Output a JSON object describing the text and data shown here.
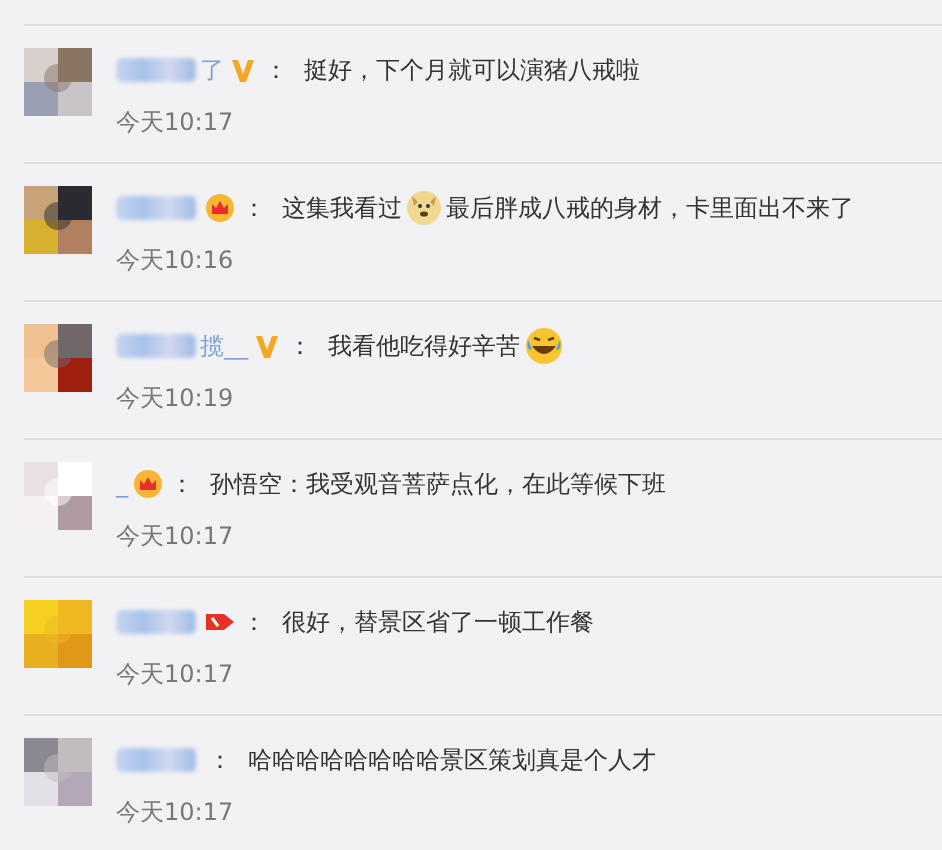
{
  "comments": [
    {
      "name": "了",
      "blurred": true,
      "badge": {
        "kind": "v"
      },
      "separator": "：",
      "parts": [
        {
          "kind": "text",
          "text": "挺好，下个月就可以演猪八戒啦"
        }
      ],
      "time": "今天10:17"
    },
    {
      "blurred": true,
      "badge": {
        "kind": "crown"
      },
      "separator": "：",
      "parts": [
        {
          "kind": "text",
          "text": "这集我看过"
        },
        {
          "kind": "dog"
        },
        {
          "kind": "text",
          "text": "最后胖成八戒的身材，卡里面出不来了"
        }
      ],
      "time": "今天10:16"
    },
    {
      "name": "揽__",
      "blurred": true,
      "badge": {
        "kind": "v"
      },
      "separator": "：",
      "parts": [
        {
          "kind": "text",
          "text": "我看他吃得好辛苦"
        },
        {
          "kind": "laugh"
        }
      ],
      "time": "今天10:19"
    },
    {
      "name": "_",
      "blurred": false,
      "badge": {
        "kind": "crown"
      },
      "separator": "：",
      "parts": [
        {
          "kind": "text",
          "text": "孙悟空：我受观音菩萨点化，在此等候下班"
        }
      ],
      "time": "今天10:17"
    },
    {
      "blurred": true,
      "badge": {
        "kind": "tag"
      },
      "separator": "：",
      "parts": [
        {
          "kind": "text",
          "text": "很好，替景区省了一顿工作餐"
        }
      ],
      "time": "今天10:17"
    },
    {
      "blurred": true,
      "separator": "：",
      "parts": [
        {
          "kind": "text",
          "text": "哈哈哈哈哈哈哈哈景区策划真是个人才"
        }
      ],
      "time": "今天10:17"
    }
  ]
}
